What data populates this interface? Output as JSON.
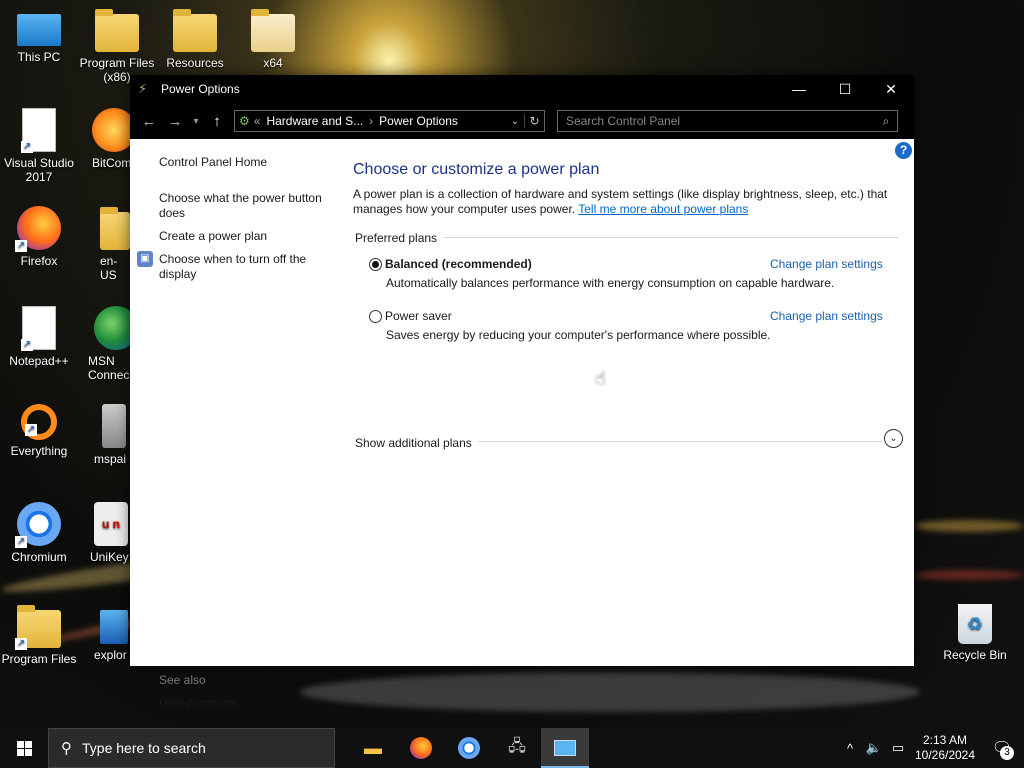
{
  "desktop": {
    "icons": [
      {
        "label": "This PC",
        "icon": "computer-icon"
      },
      {
        "label": "Program Files (x86)",
        "icon": "folder-icon"
      },
      {
        "label": "Resources",
        "icon": "folder-icon"
      },
      {
        "label": "x64",
        "icon": "folder-icon"
      },
      {
        "label": "Visual Studio 2017",
        "icon": "document-icon"
      },
      {
        "label": "BitCom",
        "icon": "bitcomet-icon"
      },
      {
        "label": "Firefox",
        "icon": "firefox-icon"
      },
      {
        "label": "en-US",
        "icon": "folder-icon"
      },
      {
        "label": "Notepad++",
        "icon": "document-icon"
      },
      {
        "label": "MSN Connec",
        "icon": "globe-icon"
      },
      {
        "label": "Everything",
        "icon": "everything-icon"
      },
      {
        "label": "mspai",
        "icon": "paint-icon"
      },
      {
        "label": "Chromium",
        "icon": "chromium-icon"
      },
      {
        "label": "UniKey",
        "icon": "unikey-icon"
      },
      {
        "label": "Program Files",
        "icon": "folder-icon"
      },
      {
        "label": "explor",
        "icon": "explorer-icon"
      },
      {
        "label": "Recycle Bin",
        "icon": "recycle-bin-icon"
      }
    ]
  },
  "window": {
    "title": "Power Options",
    "breadcrumb": {
      "prefix": "«",
      "items": [
        "Hardware and S...",
        "Power Options"
      ]
    },
    "search_placeholder": "Search Control Panel"
  },
  "left_pane": {
    "links": [
      "Control Panel Home",
      "Choose what the power button does",
      "Create a power plan",
      "Choose when to turn off the display"
    ],
    "see_also_label": "See also",
    "see_also_links": [
      "User Accounts"
    ]
  },
  "main": {
    "heading": "Choose or customize a power plan",
    "description": "A power plan is a collection of hardware and system settings (like display brightness, sleep, etc.) that manages how your computer uses power.",
    "learn_more_link": "Tell me more about power plans",
    "preferred_plans_label": "Preferred plans",
    "plans": [
      {
        "name": "Balanced (recommended)",
        "description": "Automatically balances performance with energy consumption on capable hardware.",
        "selected": true,
        "change_link": "Change plan settings"
      },
      {
        "name": "Power saver",
        "description": "Saves energy by reducing your computer's performance where possible.",
        "selected": false,
        "change_link": "Change plan settings"
      }
    ],
    "show_additional_label": "Show additional plans",
    "help": "?"
  },
  "taskbar": {
    "search_text": "Type here to search",
    "apps": [
      "file-explorer-icon",
      "firefox-icon",
      "chromium-icon",
      "network-drive-icon",
      "control-panel-icon"
    ],
    "clock_time": "2:13 AM",
    "clock_date": "10/26/2024",
    "notification_count": "3"
  }
}
